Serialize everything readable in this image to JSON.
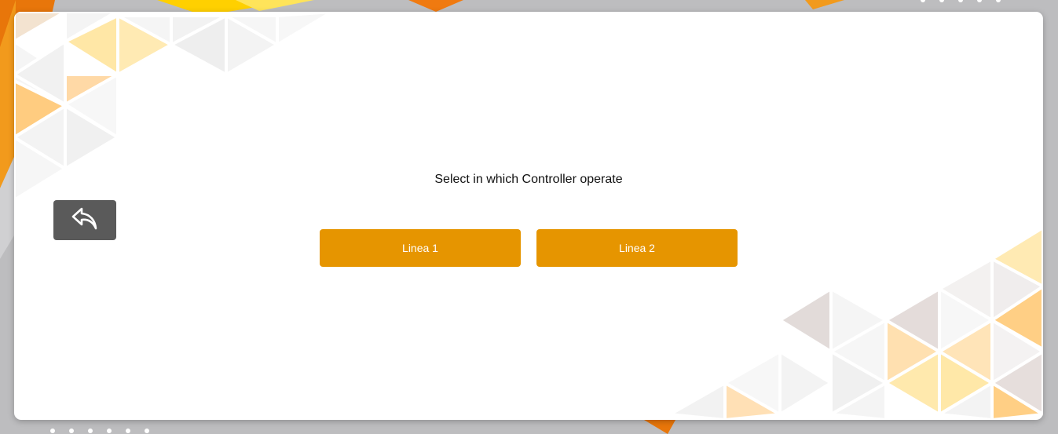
{
  "prompt": "Select in which Controller operate",
  "buttons": [
    {
      "label": "Linea 1"
    },
    {
      "label": "Linea 2"
    }
  ],
  "icons": {
    "back": "reply-arrow-icon"
  },
  "colors": {
    "accent": "#e69500",
    "back_button": "#5a5a5a",
    "card": "#ffffff",
    "backdrop": "#bdbdbf"
  }
}
